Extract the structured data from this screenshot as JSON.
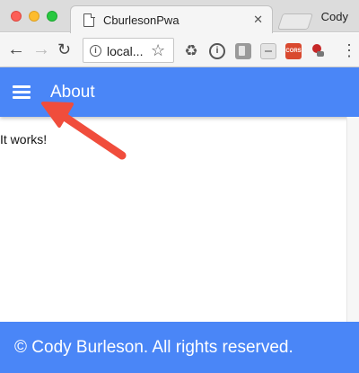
{
  "browser": {
    "tab_title": "CburlesonPwa",
    "tab_close": "✕",
    "profile_name": "Cody",
    "url": "local...",
    "nav": {
      "back": "←",
      "forward": "→",
      "reload": "↻"
    },
    "star": "☆",
    "menu": "⋮",
    "extensions": {
      "recycle": "♻",
      "info": "i",
      "cors": "CORS"
    }
  },
  "app": {
    "header_title": "About",
    "content": "It works!",
    "footer": "© Cody Burleson. All rights reserved."
  },
  "colors": {
    "app_bar": "#4a86f7",
    "annotation_arrow": "#f04d3c"
  },
  "icons": [
    "menu-icon",
    "info-icon",
    "star-icon",
    "recycle-icon",
    "page-icon",
    "close-icon",
    "chrome-menu-icon"
  ]
}
